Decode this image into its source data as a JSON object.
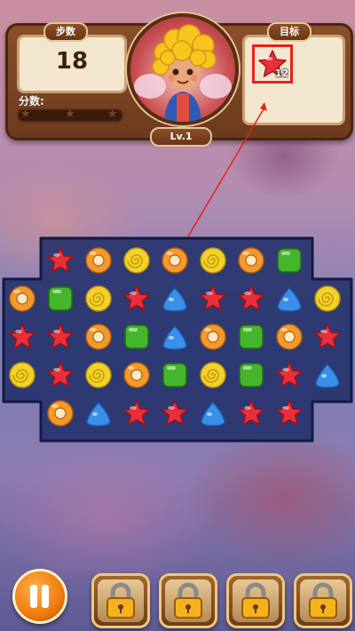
{
  "hud": {
    "moves_label": "步数",
    "moves_value": "18",
    "score_label": "分数:",
    "score_progress": 0,
    "goal_label": "目标",
    "goal_item": "red-star-candy",
    "goal_count": "12",
    "level": "Lv.1"
  },
  "board": {
    "rows": [
      [
        null,
        "star",
        "donut",
        "swirl",
        "donut",
        "swirl",
        "donut",
        "square",
        null
      ],
      [
        "donut",
        "square",
        "swirl",
        "star",
        "drop",
        "star",
        "star",
        "drop",
        "swirl"
      ],
      [
        "star",
        "star",
        "donut",
        "square",
        "drop",
        "donut",
        "square",
        "donut",
        "star"
      ],
      [
        "swirl",
        "star",
        "swirl",
        "donut",
        "square",
        "swirl",
        "square",
        "star",
        "drop"
      ],
      [
        null,
        "donut",
        "drop",
        "star",
        "star",
        "drop",
        "star",
        "star",
        null
      ]
    ],
    "candy_colors": {
      "star": "#e8303a",
      "donut": "#f29a2e",
      "swirl": "#f2d22a",
      "square": "#46b52e",
      "drop": "#3a8fe8"
    }
  },
  "bottom": {
    "pause_icon": "pause-icon",
    "boosters": [
      "locked",
      "locked",
      "locked",
      "locked"
    ]
  },
  "colors": {
    "hud_wood": "#7a431f",
    "board_bg": "#1f2a5e",
    "highlight": "#e8201c"
  }
}
